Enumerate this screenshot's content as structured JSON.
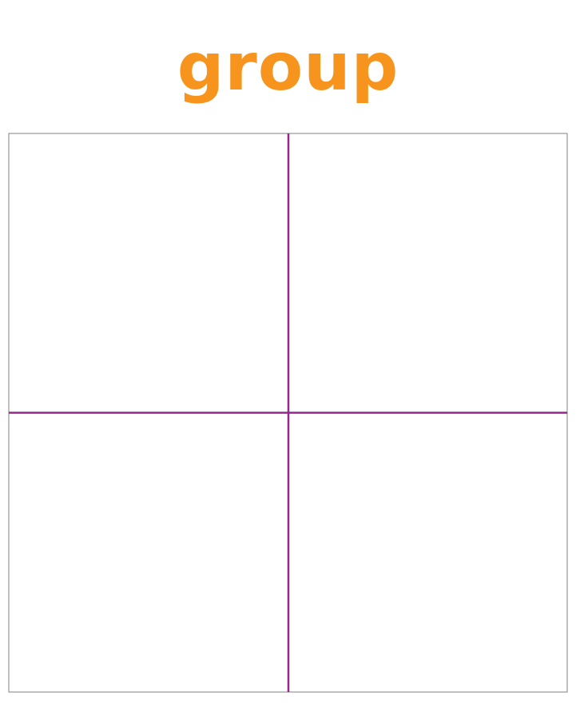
{
  "title": "group",
  "colors": {
    "title": "#f7941d",
    "frame": "#808080",
    "divider": "#93278f",
    "background": "#ffffff"
  },
  "diagram": {
    "type": "quadrant-grid",
    "rows": 2,
    "columns": 2
  }
}
